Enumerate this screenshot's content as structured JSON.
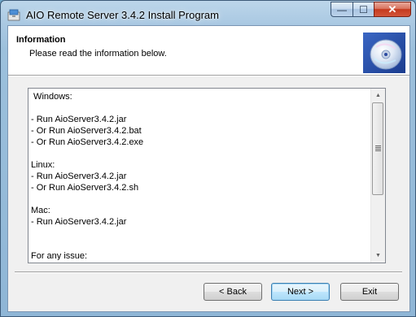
{
  "window": {
    "title": "AIO Remote Server 3.4.2 Install Program",
    "caption_buttons": {
      "minimize": "—",
      "maximize": "☐",
      "close": "✕"
    }
  },
  "header": {
    "title": "Information",
    "subtitle": "Please read the information below.",
    "image_icon": "cd-disc-icon"
  },
  "info": {
    "lines": [
      " Windows:",
      "",
      "- Run AioServer3.4.2.jar",
      "- Or Run AioServer3.4.2.bat",
      "- Or Run AioServer3.4.2.exe",
      "",
      "Linux:",
      "- Run AioServer3.4.2.jar",
      "- Or Run AioServer3.4.2.sh",
      "",
      "Mac:",
      "- Run AioServer3.4.2.jar",
      "",
      "",
      "For any issue:"
    ]
  },
  "buttons": {
    "back": "< Back",
    "next": "Next >",
    "exit": "Exit"
  },
  "colors": {
    "accent": "#3c7fb1",
    "close_red": "#c53a1f"
  }
}
